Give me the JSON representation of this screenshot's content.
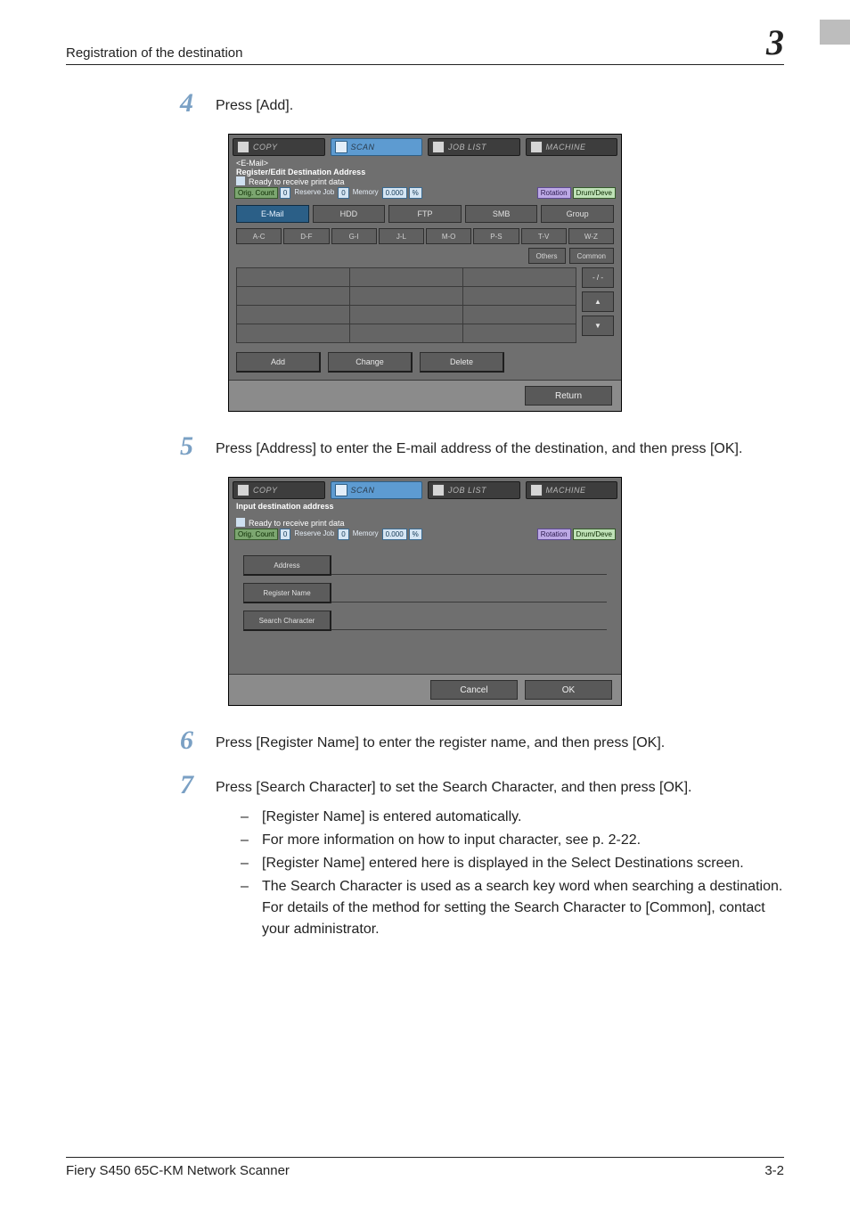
{
  "header": {
    "title": "Registration of the destination",
    "chapter": "3"
  },
  "footer": {
    "product": "Fiery S450 65C-KM Network Scanner",
    "page": "3-2"
  },
  "steps": {
    "s4": {
      "num": "4",
      "text": "Press [Add]."
    },
    "s5": {
      "num": "5",
      "text": "Press [Address] to enter the E-mail address of the destination, and then press [OK]."
    },
    "s6": {
      "num": "6",
      "text": "Press [Register Name] to enter the register name, and then press [OK]."
    },
    "s7": {
      "num": "7",
      "text": "Press [Search Character] to set the Search Character, and then press [OK]."
    }
  },
  "bullets": {
    "b1": "[Register Name] is entered automatically.",
    "b2": "For more information on how to input character, see p. 2-22.",
    "b3": "[Register Name] entered here is displayed in the Select Destinations screen.",
    "b4": "The Search Character is used as a search key word when searching a destination. For details of the method for setting the Search Character to [Common], contact your administrator."
  },
  "panelTabs": {
    "copy": "COPY",
    "scan": "SCAN",
    "joblist": "JOB LIST",
    "machine": "MACHINE"
  },
  "panel1": {
    "screenTitle1": "<E-Mail>",
    "screenTitle2": "Register/Edit Destination Address",
    "statusMsg": "Ready to receive print data",
    "sbar": {
      "orig": "Orig. Count",
      "origVal": "0",
      "resv": "Reserve Job",
      "resvVal": "0",
      "mem": "Memory",
      "memVal": "0.000",
      "memPct": "%",
      "rot": "Rotation",
      "drum": "Drum/Deve"
    },
    "tabs": {
      "email": "E-Mail",
      "hdd": "HDD",
      "ftp": "FTP",
      "smb": "SMB",
      "group": "Group"
    },
    "alpha": {
      "ac": "A-C",
      "df": "D-F",
      "gi": "G-I",
      "jl": "J-L",
      "mo": "M-O",
      "ps": "P-S",
      "tv": "T-V",
      "wz": "W-Z"
    },
    "side": {
      "others": "Others",
      "common": "Common",
      "pager": "- / -",
      "up": "▲",
      "down": "▼"
    },
    "actions": {
      "add": "Add",
      "change": "Change",
      "delete": "Delete"
    },
    "returnBtn": "Return"
  },
  "panel2": {
    "screenTitle": "Input destination address",
    "statusMsg": "Ready to receive print data",
    "sbar": {
      "orig": "Orig. Count",
      "origVal": "0",
      "resv": "Reserve Job",
      "resvVal": "0",
      "mem": "Memory",
      "memVal": "0.000",
      "memPct": "%",
      "rot": "Rotation",
      "drum": "Drum/Deve"
    },
    "form": {
      "address": "Address",
      "regName": "Register Name",
      "searchChar": "Search Character"
    },
    "cancel": "Cancel",
    "ok": "OK"
  }
}
